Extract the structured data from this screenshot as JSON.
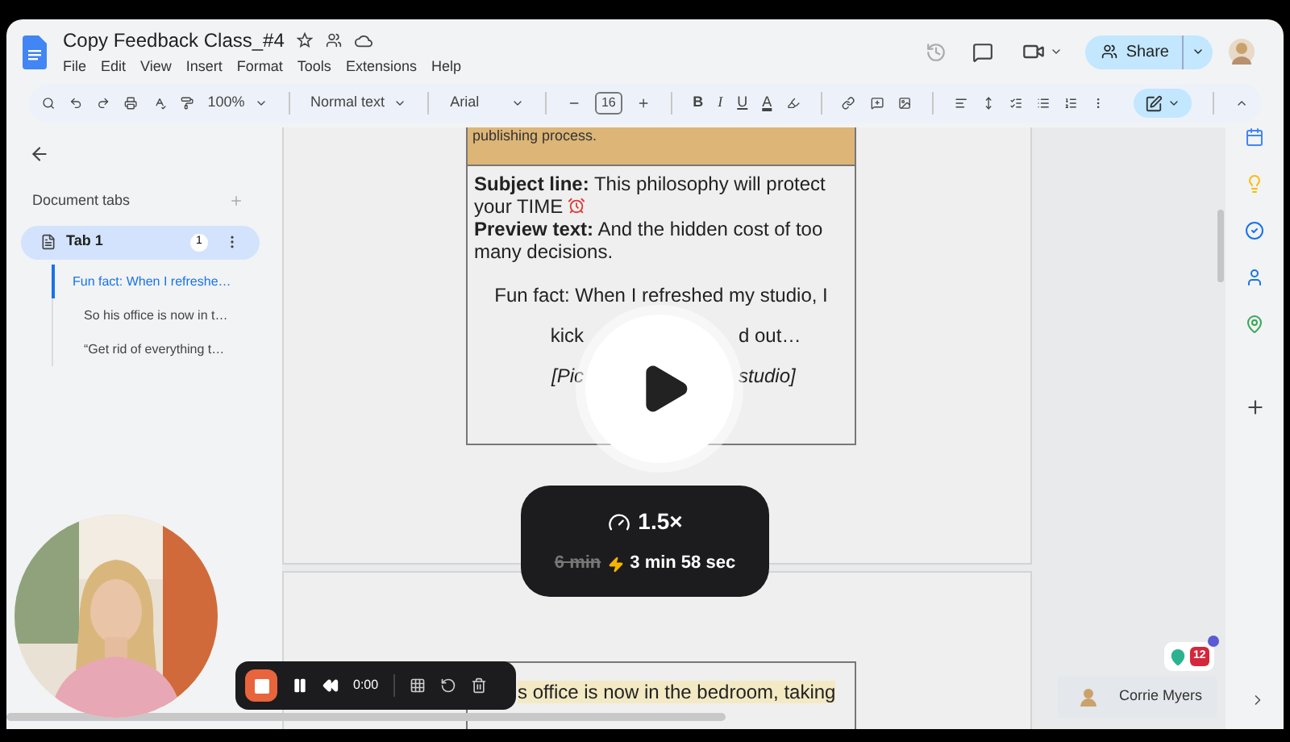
{
  "document": {
    "title": "Copy Feedback Class_#4",
    "menu": [
      "File",
      "Edit",
      "View",
      "Insert",
      "Format",
      "Tools",
      "Extensions",
      "Help"
    ]
  },
  "header": {
    "share": "Share"
  },
  "toolbar": {
    "zoom": "100%",
    "style": "Normal text",
    "font": "Arial",
    "font_size": "16",
    "format_buttons": [
      "B",
      "I",
      "U",
      "A"
    ]
  },
  "sidebar": {
    "heading": "Document tabs",
    "tabs": [
      {
        "label": "Tab 1",
        "count": "1",
        "selected": true,
        "outline": [
          {
            "text": "Fun fact: When I refreshe…",
            "selected": true,
            "indent": false
          },
          {
            "text": "So his office is now in t…",
            "selected": false,
            "indent": true
          },
          {
            "text": "“Get rid of everything t…",
            "selected": false,
            "indent": true
          }
        ]
      }
    ]
  },
  "page_one": {
    "note": "publishing process.",
    "paragraphs": [
      "**Subject line:** This philosophy will protect your TIME",
      "**Preview text:** And the hidden cost of too many decisions."
    ],
    "centered_lines": [
      {
        "kind": "whole",
        "left": "Fun fact: When I refreshed my studio, I",
        "italic": false
      },
      {
        "kind": "split",
        "left": "kick",
        "right": "d out…",
        "italic": false
      },
      {
        "kind": "split",
        "left": "[Pic",
        "right": "studio]",
        "italic": true
      }
    ]
  },
  "page_two": {
    "highlighted_text": "s office is now in the bedroom, taking"
  },
  "speed": {
    "rate": "1.5×",
    "original": "6 min",
    "reduced": "3 min 58 sec"
  },
  "recorder": {
    "time": "0:00"
  },
  "badge": {
    "count": "12"
  },
  "collaborator": {
    "name": "Corrie Myers"
  }
}
